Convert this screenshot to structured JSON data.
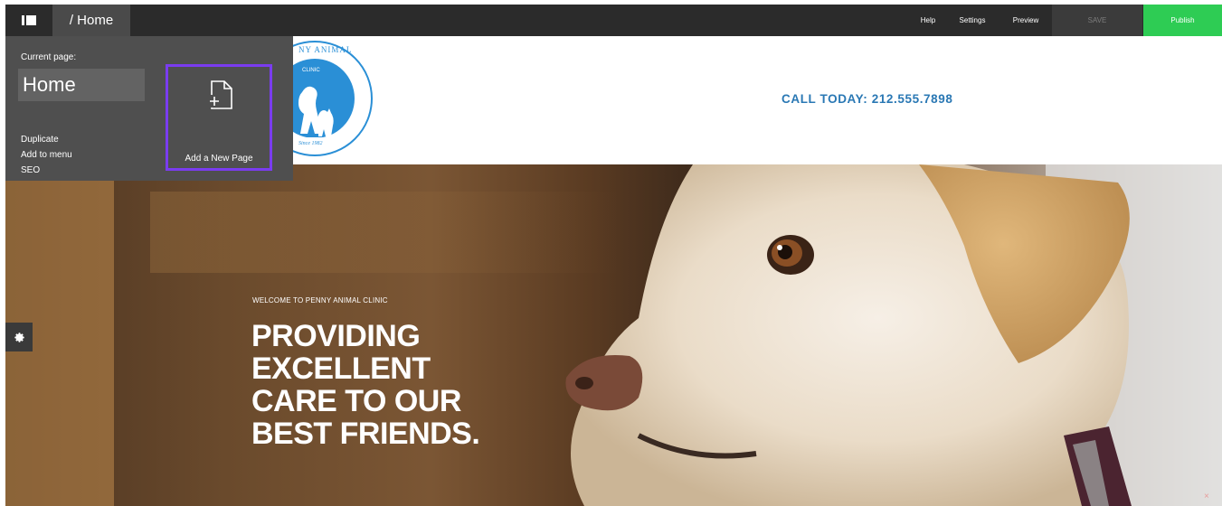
{
  "toolbar": {
    "sidebar_icon": "sidebar-toggle-icon",
    "breadcrumb": "/ Home",
    "help": "Help",
    "settings": "Settings",
    "preview": "Preview",
    "save": "SAVE",
    "publish": "Publish",
    "publish_color": "#2ecc54"
  },
  "page_panel": {
    "current_page_label": "Current page:",
    "current_page_name": "Home",
    "actions": [
      "Duplicate",
      "Add to menu",
      "SEO"
    ],
    "add_new_page": "Add a New Page",
    "add_new_page_icon": "add-page-icon",
    "highlight_color": "#7a3cf0"
  },
  "site": {
    "logo": {
      "top_text": "NY ANIMAL",
      "clinic": "CLINIC",
      "since": "Since 1982",
      "color": "#2a8fd6"
    },
    "call_today": "CALL TODAY: 212.555.7898",
    "hero": {
      "welcome": "WELCOME TO PENNY ANIMAL CLINIC",
      "headline": [
        "PROVIDING",
        "EXCELLENT",
        "CARE TO OUR",
        "BEST FRIENDS."
      ]
    }
  },
  "side_controls": {
    "gear_icon": "gear-icon",
    "close": "×"
  }
}
